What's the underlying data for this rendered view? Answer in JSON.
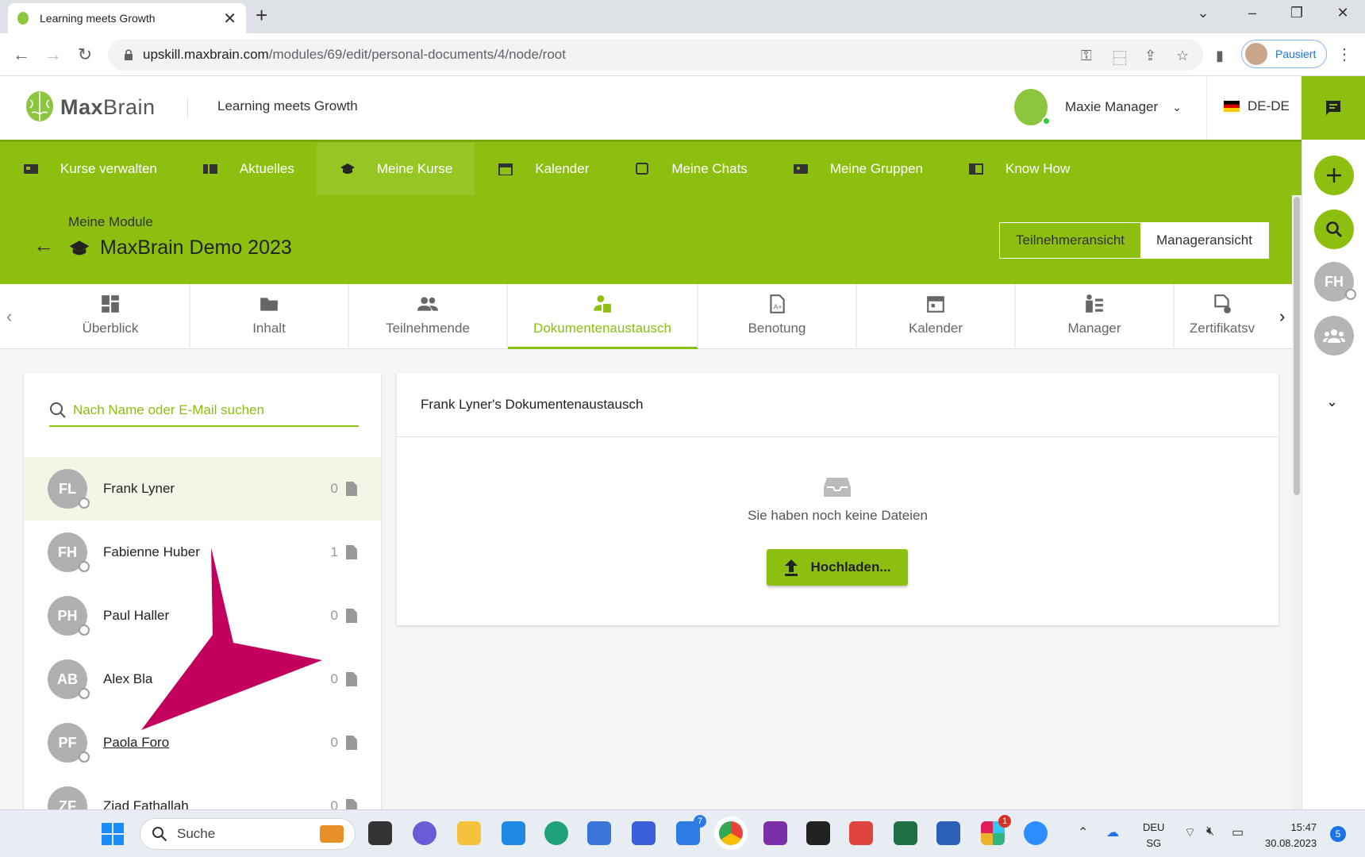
{
  "browser": {
    "tab_title": "Learning meets Growth",
    "url_host": "upskill.maxbrain.com",
    "url_path": "/modules/69/edit/personal-documents/4/node/root",
    "profile_label": "Pausiert"
  },
  "header": {
    "brand_bold": "Max",
    "brand_light": "Brain",
    "tagline": "Learning meets Growth",
    "user_name": "Maxie Manager",
    "language": "DE-DE"
  },
  "nav": {
    "items": [
      {
        "label": "Kurse verwalten",
        "icon": "card-icon"
      },
      {
        "label": "Aktuelles",
        "icon": "news-icon"
      },
      {
        "label": "Meine Kurse",
        "icon": "graduation-cap-icon",
        "active": true
      },
      {
        "label": "Kalender",
        "icon": "calendar-icon"
      },
      {
        "label": "Meine Chats",
        "icon": "chat-icon"
      },
      {
        "label": "Meine Gruppen",
        "icon": "group-card-icon"
      },
      {
        "label": "Know How",
        "icon": "book-icon"
      }
    ]
  },
  "module": {
    "breadcrumb": "Meine Module",
    "title": "MaxBrain Demo 2023",
    "view_participant": "Teilnehmeransicht",
    "view_manager": "Manageransicht"
  },
  "tabs": [
    {
      "label": "Überblick",
      "icon": "dashboard-icon"
    },
    {
      "label": "Inhalt",
      "icon": "folder-icon"
    },
    {
      "label": "Teilnehmende",
      "icon": "people-icon"
    },
    {
      "label": "Dokumentenaustausch",
      "icon": "person-doc-icon",
      "active": true
    },
    {
      "label": "Benotung",
      "icon": "grade-doc-icon"
    },
    {
      "label": "Kalender",
      "icon": "calendar-icon"
    },
    {
      "label": "Manager",
      "icon": "manager-icon"
    },
    {
      "label": "Zertifikatsv",
      "icon": "certificate-icon"
    }
  ],
  "left_panel": {
    "search_placeholder": "Nach Name oder E-Mail suchen",
    "people": [
      {
        "initials": "FL",
        "name": "Frank Lyner",
        "count": "0"
      },
      {
        "initials": "FH",
        "name": "Fabienne Huber",
        "count": "1"
      },
      {
        "initials": "PH",
        "name": "Paul Haller",
        "count": "0"
      },
      {
        "initials": "AB",
        "name": "Alex Bla",
        "count": "0"
      },
      {
        "initials": "PF",
        "name": "Paola Foro",
        "count": "0"
      },
      {
        "initials": "ZF",
        "name": "Ziad Fathallah",
        "count": "0"
      }
    ]
  },
  "right_panel": {
    "title": "Frank Lyner's Dokumentenaustausch",
    "empty_text": "Sie haben noch keine Dateien",
    "upload_label": "Hochladen..."
  },
  "rail": {
    "user_initials": "FH"
  },
  "taskbar": {
    "search_label": "Suche",
    "lang_line1": "DEU",
    "lang_line2": "SG",
    "time": "15:47",
    "date": "30.08.2023",
    "notification_count": "5",
    "todo_badge": "7",
    "slack_badge": "1"
  },
  "colors": {
    "brand_green": "#8cbf0f",
    "arrow_magenta": "#c4005e"
  }
}
